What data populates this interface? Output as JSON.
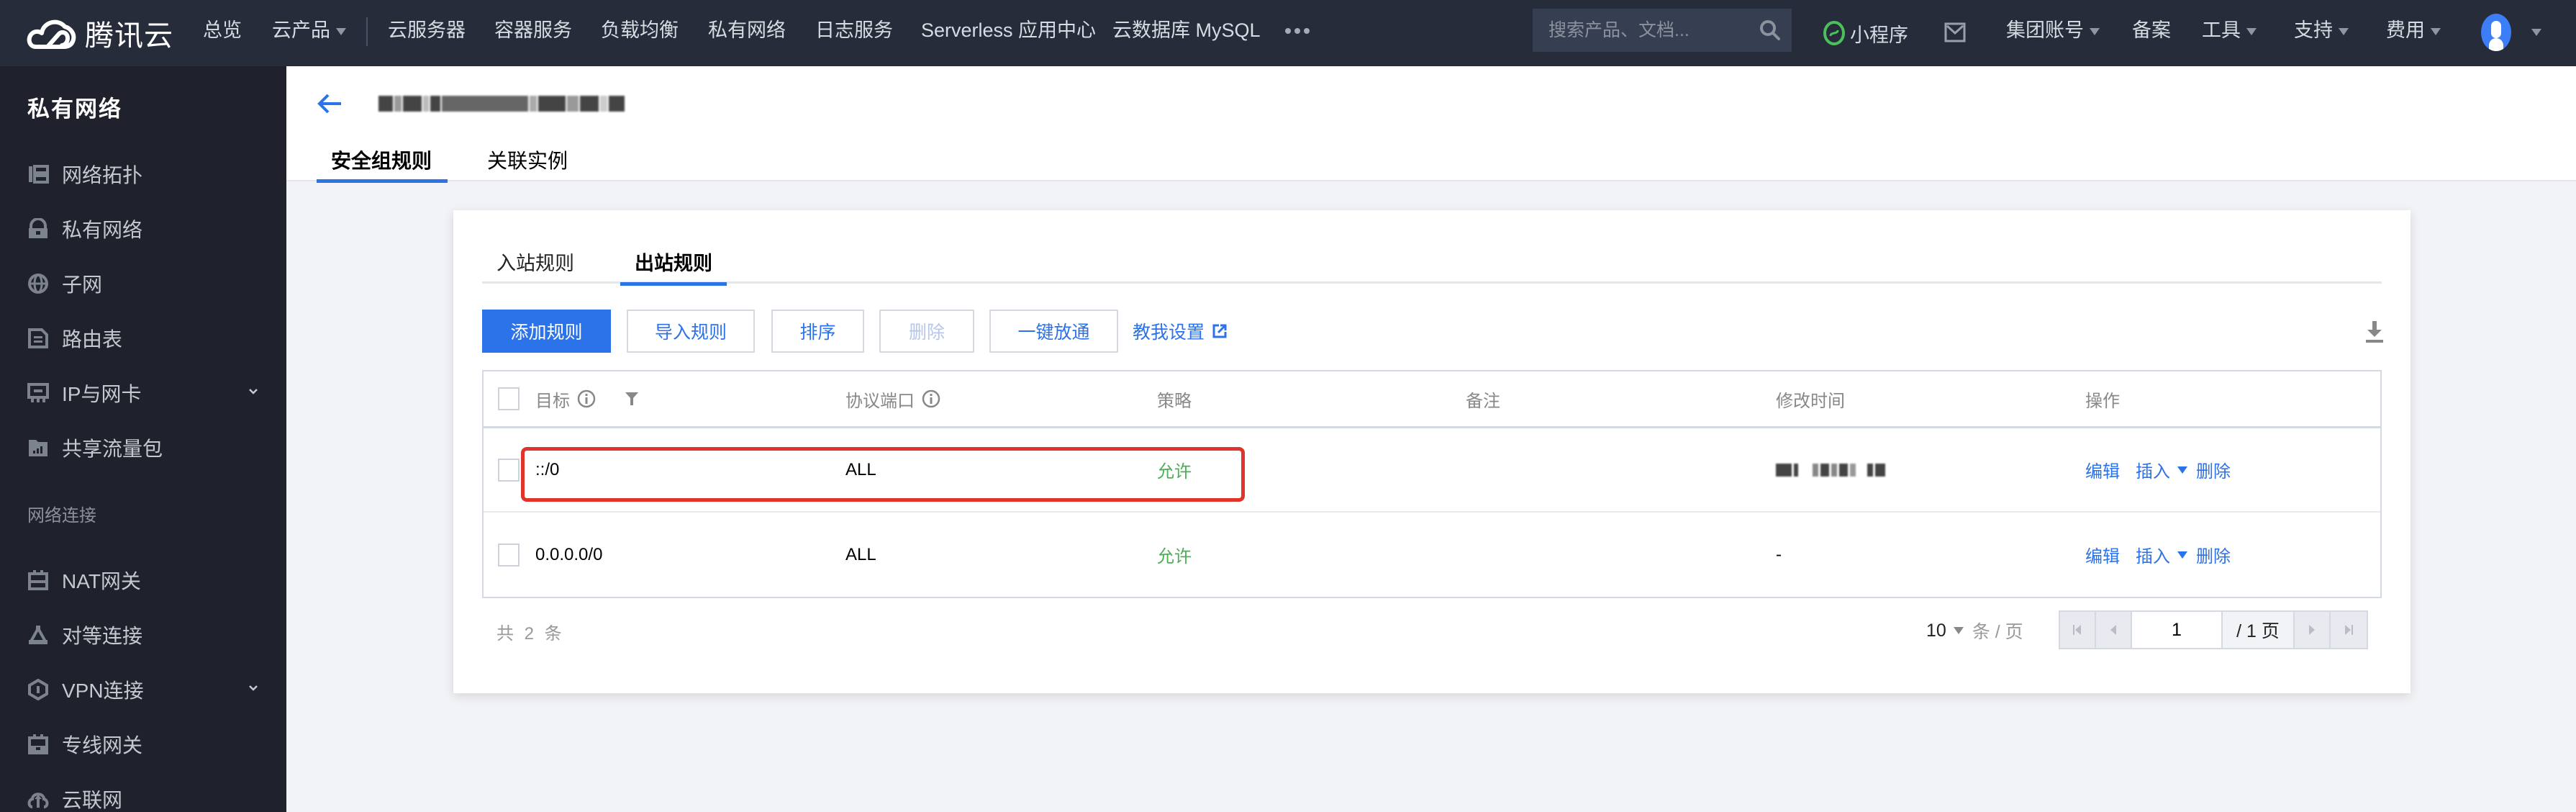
{
  "topbar": {
    "brand": "腾讯云",
    "nav": [
      {
        "label": "总览"
      },
      {
        "label": "云产品",
        "dropdown": true
      },
      {
        "label": "云服务器"
      },
      {
        "label": "容器服务"
      },
      {
        "label": "负载均衡"
      },
      {
        "label": "私有网络"
      },
      {
        "label": "日志服务"
      },
      {
        "label": "Serverless 应用中心"
      },
      {
        "label": "云数据库 MySQL"
      }
    ],
    "more_icon": "more-dots-icon",
    "search_placeholder": "搜索产品、文档...",
    "mini_program": "小程序",
    "right_nav": [
      {
        "label": "集团账号",
        "dropdown": true
      },
      {
        "label": "备案"
      },
      {
        "label": "工具",
        "dropdown": true
      },
      {
        "label": "支持",
        "dropdown": true
      },
      {
        "label": "费用",
        "dropdown": true
      }
    ]
  },
  "sidebar": {
    "title": "私有网络",
    "items": [
      {
        "label": "网络拓扑",
        "icon": "topology-icon"
      },
      {
        "label": "私有网络",
        "icon": "lock-icon"
      },
      {
        "label": "子网",
        "icon": "globe-icon"
      },
      {
        "label": "路由表",
        "icon": "document-icon"
      },
      {
        "label": "IP与网卡",
        "icon": "nic-icon",
        "expandable": true
      },
      {
        "label": "共享流量包",
        "icon": "traffic-package-icon"
      }
    ],
    "group_label": "网络连接",
    "group_items": [
      {
        "label": "NAT网关",
        "icon": "gateway-icon"
      },
      {
        "label": "对等连接",
        "icon": "peering-icon"
      },
      {
        "label": "VPN连接",
        "icon": "vpn-icon",
        "expandable": true
      },
      {
        "label": "专线网关",
        "icon": "direct-connect-icon"
      },
      {
        "label": "云联网",
        "icon": "ccn-icon"
      }
    ]
  },
  "header": {
    "title_redacted": true,
    "tabs": [
      {
        "label": "安全组规则",
        "active": true
      },
      {
        "label": "关联实例",
        "active": false
      }
    ]
  },
  "card": {
    "tabs": [
      {
        "label": "入站规则",
        "active": false
      },
      {
        "label": "出站规则",
        "active": true
      }
    ],
    "toolbar": {
      "add": "添加规则",
      "import": "导入规则",
      "sort": "排序",
      "delete": "删除",
      "open_all": "一键放通",
      "help": "教我设置"
    },
    "table": {
      "columns": [
        "目标",
        "协议端口",
        "策略",
        "备注",
        "修改时间",
        "操作"
      ],
      "rows": [
        {
          "target": "::/0",
          "protocol": "ALL",
          "policy": "允许",
          "remark": "",
          "modified": "(redacted)",
          "modified_redacted": true,
          "highlighted": true
        },
        {
          "target": "0.0.0.0/0",
          "protocol": "ALL",
          "policy": "允许",
          "remark": "",
          "modified": "-",
          "modified_redacted": false,
          "highlighted": false
        }
      ],
      "actions": {
        "edit": "编辑",
        "insert": "插入",
        "delete": "删除"
      }
    },
    "footer": {
      "total": "共 2 条",
      "page_size": "10",
      "page_size_unit": "条 / 页",
      "current_page": "1",
      "total_pages": "/ 1 页"
    }
  },
  "colors": {
    "accent": "#2c72e8",
    "allow": "#4cae55",
    "highlight": "#e0332a",
    "topbar": "#262c3a",
    "sidebar": "#1f222c"
  }
}
